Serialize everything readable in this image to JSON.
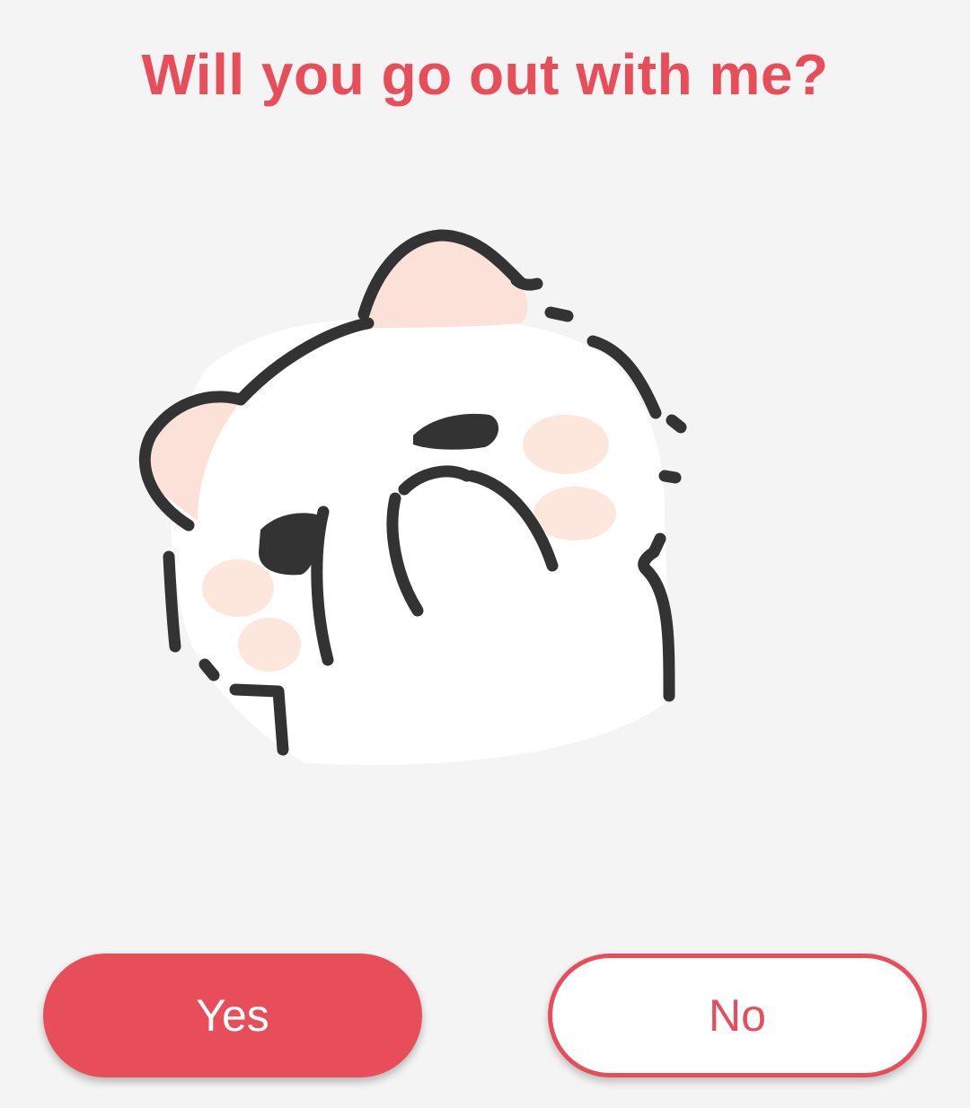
{
  "question": {
    "text": "Will you go out with me?"
  },
  "sticker": {
    "icon": "shy-cat-covering-face-icon"
  },
  "buttons": {
    "yes_label": "Yes",
    "no_label": "No"
  },
  "colors": {
    "accent": "#e84e5a",
    "background": "#f4f4f4",
    "outline": "#333333",
    "blush": "#fde6dc",
    "ear": "#fbe1d7"
  }
}
